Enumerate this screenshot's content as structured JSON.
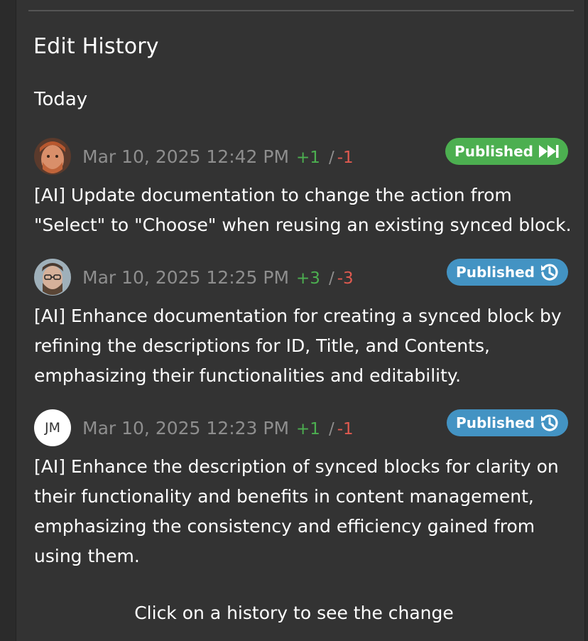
{
  "panel": {
    "title": "Edit History",
    "section": "Today"
  },
  "entries": [
    {
      "avatar": "red-haired-person-photo",
      "date": "Mar 10, 2025 12:42 PM",
      "added": "+1",
      "separator": "/",
      "removed": "-1",
      "status": "Published",
      "status_icon": "fast-forward-icon",
      "status_color": "#4caf50",
      "description": "[AI] Update documentation to change the action from \"Select\" to \"Choose\" when reusing an existing synced block."
    },
    {
      "avatar": "bearded-person-with-glasses-photo",
      "date": "Mar 10, 2025 12:25 PM",
      "added": "+3",
      "separator": "/",
      "removed": "-3",
      "status": "Published",
      "status_icon": "history-icon",
      "status_color": "#4393c3",
      "description": "[AI] Enhance documentation for creating a synced block by refining the descriptions for ID, Title, and Contents, emphasizing their functionalities and editability."
    },
    {
      "avatar_initials": "JM",
      "date": "Mar 10, 2025 12:23 PM",
      "added": "+1",
      "separator": "/",
      "removed": "-1",
      "status": "Published",
      "status_icon": "history-icon",
      "status_color": "#4393c3",
      "description": "[AI] Enhance the description of synced blocks for clarity on their functionality and benefits in content management, emphasizing the consistency and efficiency gained from using them."
    }
  ],
  "footer": {
    "hint": "Click on a history to see the change"
  },
  "colors": {
    "background": "#333333",
    "added": "#4caf50",
    "removed": "#e05a50",
    "muted": "#8e8e8e"
  }
}
